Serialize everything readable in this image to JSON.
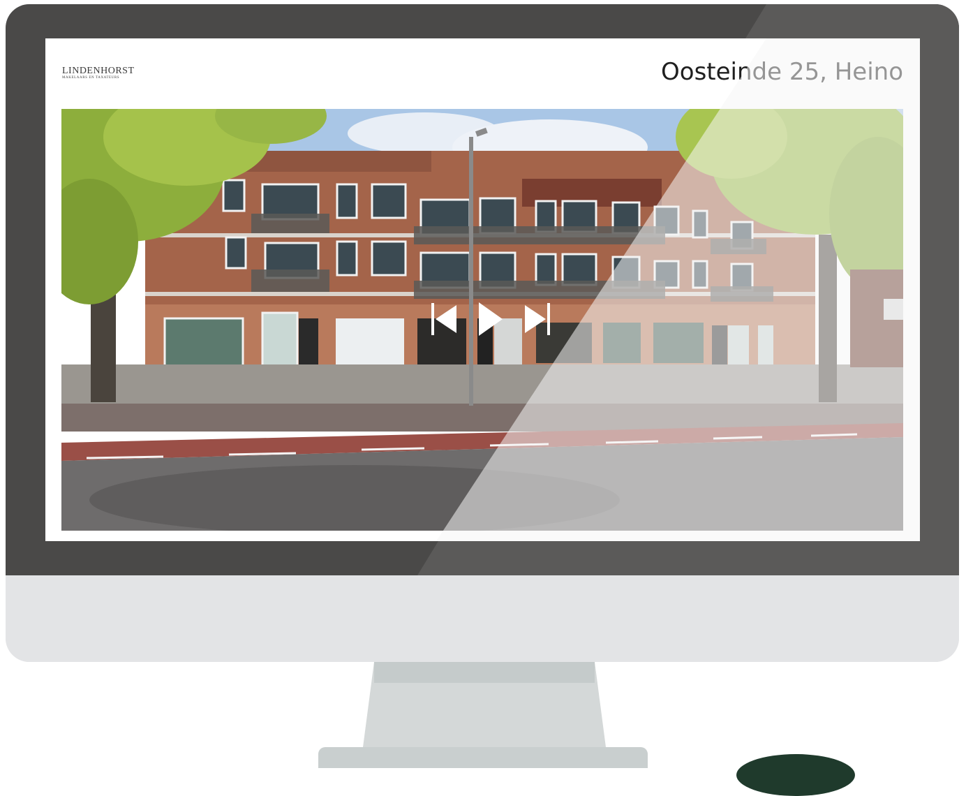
{
  "logo": {
    "name": "LINDENHORST",
    "tagline": "MAKELAARS EN TAXATEURS"
  },
  "listing": {
    "address": "Oosteinde 25, Heino"
  },
  "gallery": {
    "controls": {
      "previous_icon": "skip-previous-icon",
      "play_icon": "play-icon",
      "next_icon": "skip-next-icon"
    }
  },
  "colors": {
    "bezel": "#4a4948",
    "chin": "#e3e4e6",
    "badge": "#1f3a2c"
  }
}
